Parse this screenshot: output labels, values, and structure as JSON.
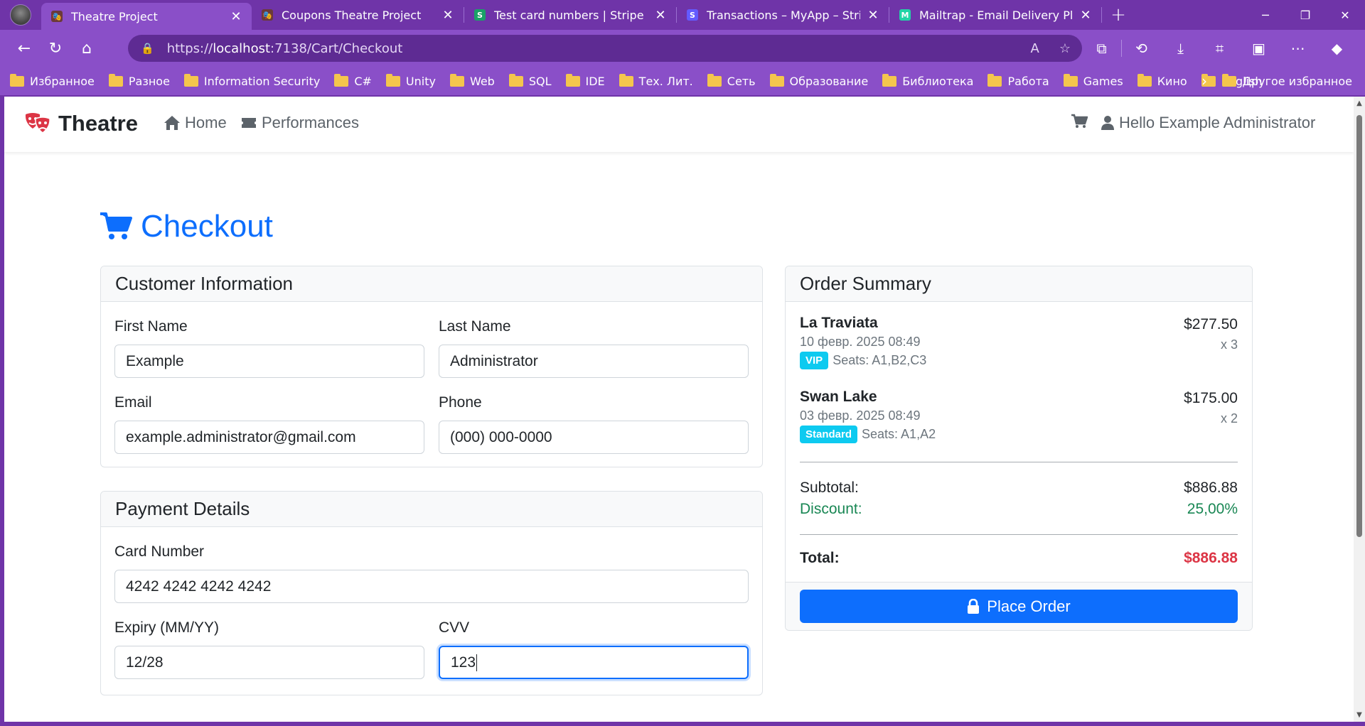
{
  "browser": {
    "tabs": [
      {
        "title": "Theatre Project",
        "favicon": "theatre-favicon",
        "active": true
      },
      {
        "title": "Coupons Theatre Project",
        "favicon": "theatre-favicon",
        "active": false
      },
      {
        "title": "Test card numbers | Stripe Docum",
        "favicon": "stripe-docs-favicon",
        "active": false
      },
      {
        "title": "Transactions – MyApp – Stripe [Te",
        "favicon": "stripe-favicon",
        "active": false
      },
      {
        "title": "Mailtrap - Email Delivery Platform",
        "favicon": "mailtrap-favicon",
        "active": false
      }
    ],
    "url": {
      "prefix": "https://",
      "host": "localhost",
      "path": ":7138/Cart/Checkout"
    },
    "bookmarks": [
      "Избранное",
      "Разное",
      "Information Security",
      "C#",
      "Unity",
      "Web",
      "SQL",
      "IDE",
      "Тех. Лит.",
      "Сеть",
      "Образование",
      "Библиотека",
      "Работа",
      "Games",
      "Кино",
      "English"
    ],
    "other_bookmarks": "Другое избранное",
    "accent_color": "#8a4fc8"
  },
  "site": {
    "brand": "Theatre",
    "nav": {
      "home": "Home",
      "performances": "Performances"
    },
    "user_greeting": "Hello Example Administrator"
  },
  "page": {
    "title": "Checkout",
    "customer": {
      "header": "Customer Information",
      "first_name_label": "First Name",
      "first_name": "Example",
      "last_name_label": "Last Name",
      "last_name": "Administrator",
      "email_label": "Email",
      "email": "example.administrator@gmail.com",
      "phone_label": "Phone",
      "phone": "(000) 000-0000"
    },
    "payment": {
      "header": "Payment Details",
      "card_label": "Card Number",
      "card": "4242 4242 4242 4242",
      "expiry_label": "Expiry (MM/YY)",
      "expiry": "12/28",
      "cvv_label": "CVV",
      "cvv": "123"
    },
    "summary": {
      "header": "Order Summary",
      "items": [
        {
          "name": "La Traviata",
          "date": "10 февр. 2025 08:49",
          "badge": "VIP",
          "seats": "Seats: A1,B2,C3",
          "price": "$277.50",
          "qty": "x 3"
        },
        {
          "name": "Swan Lake",
          "date": "03 февр. 2025 08:49",
          "badge": "Standard",
          "seats": "Seats: A1,A2",
          "price": "$175.00",
          "qty": "x 2"
        }
      ],
      "subtotal_label": "Subtotal:",
      "subtotal": "$886.88",
      "discount_label": "Discount:",
      "discount": "25,00%",
      "total_label": "Total:",
      "total": "$886.88",
      "place_order": "Place Order"
    },
    "colors": {
      "primary": "#0d6efd",
      "success": "#198754",
      "danger": "#dc3545",
      "info": "#0dcaf0"
    }
  }
}
